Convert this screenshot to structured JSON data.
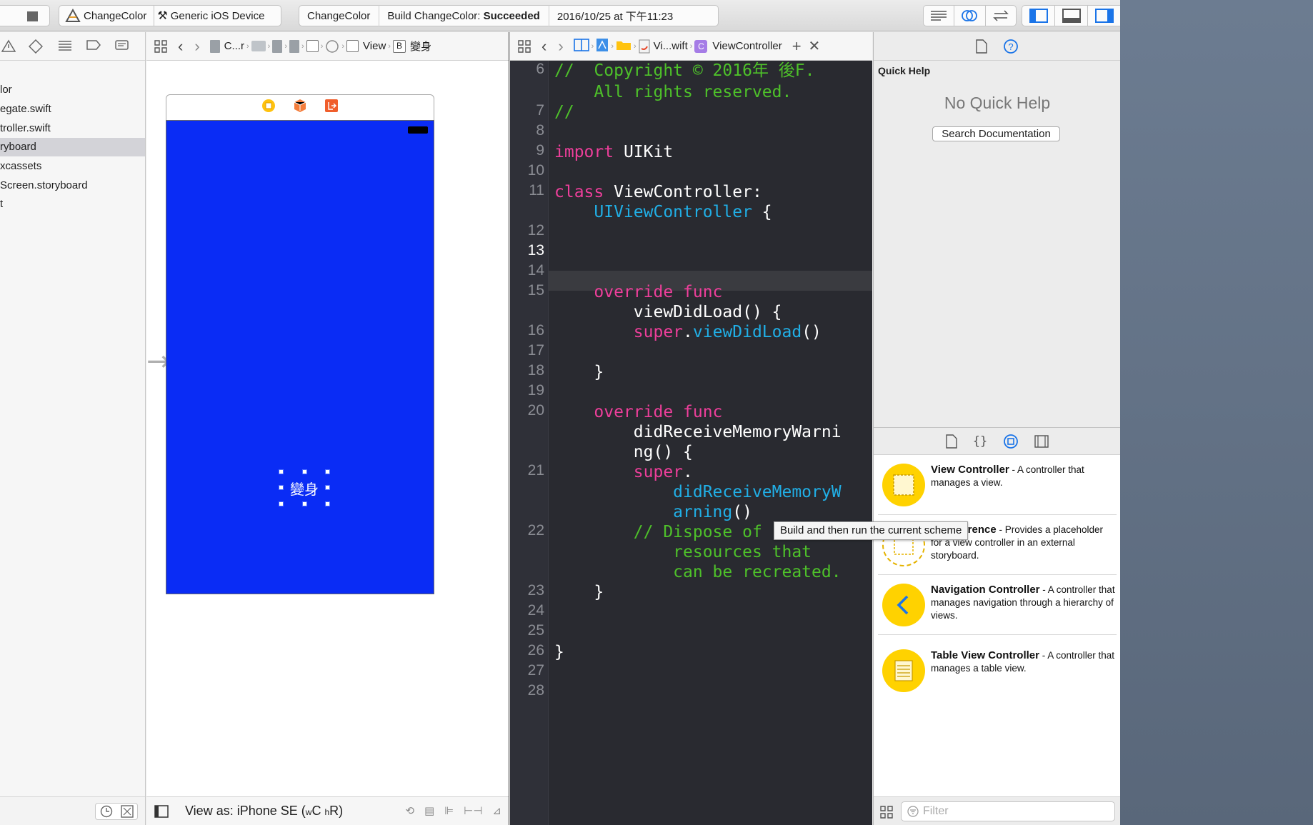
{
  "toolbar": {
    "scheme_name": "ChangeColor",
    "destination": "Generic iOS Device",
    "status_project": "ChangeColor",
    "status_prefix": "Build ChangeColor:",
    "status_result": "Succeeded",
    "status_time": "2016/10/25 at 下午11:23"
  },
  "navigator": {
    "items": [
      {
        "label": "lor"
      },
      {
        "label": "egate.swift"
      },
      {
        "label": "troller.swift"
      },
      {
        "label": "ryboard"
      },
      {
        "label": "xcassets"
      },
      {
        "label": "Screen.storyboard"
      },
      {
        "label": "t"
      }
    ]
  },
  "ib": {
    "jump": {
      "c1": "C...r",
      "view": "View",
      "button_badge": "B",
      "button": "變身"
    },
    "button_label": "變身",
    "view_as_prefix": "View as: iPhone SE (",
    "size_w": "w",
    "size_c": "C",
    "size_h": "h",
    "size_r": "R",
    "view_as_suffix": ")"
  },
  "editor": {
    "jump": {
      "file": "Vi...wift",
      "class_badge": "C",
      "class": "ViewController"
    },
    "line_numbers": [
      "6",
      "7",
      "8",
      "9",
      "10",
      "11",
      "12",
      "13",
      "14",
      "15",
      "16",
      "17",
      "18",
      "19",
      "20",
      "21",
      "22",
      "23",
      "24",
      "25",
      "26",
      "27",
      "28"
    ],
    "code": {
      "l6a": "//  Copyright © 2016年 後F.",
      "l6b": "    All rights reserved.",
      "l7": "//",
      "l9_kw": "import",
      "l9_rest": " UIKit",
      "l11_kw": "class",
      "l11_rest": " ViewController:",
      "l11b_ty": "    UIViewController",
      "l11b_rest": " {",
      "l15_kw": "    override func",
      "l15b": "        viewDidLoad() {",
      "l16_kw": "        super",
      "l16_dot": ".",
      "l16_ty": "viewDidLoad",
      "l16_rest": "()",
      "l18": "    }",
      "l20_kw": "    override func",
      "l20b": "        didReceiveMemoryWarni",
      "l20c": "        ng() {",
      "l21_kw": "        super",
      "l21_dot": ".",
      "l21b_ty": "            didReceiveMemoryW",
      "l21c_ty": "            arning",
      "l21c_rest": "()",
      "l22": "        // Dispose of",
      "l22b": "            resources that",
      "l22c": "            can be recreated.",
      "l23": "    }",
      "l26": "}"
    }
  },
  "tooltip": "Build and then run the current scheme",
  "inspector": {
    "title": "Quick Help",
    "empty": "No Quick Help",
    "search_button": "Search Documentation"
  },
  "library": {
    "items": [
      {
        "title": "View Controller",
        "desc": " - A controller that manages a view."
      },
      {
        "title": "rd Reference",
        "desc": " - Provides a placeholder for a view controller in an external storyboard."
      },
      {
        "title": "Navigation Controller",
        "desc": " - A controller that manages navigation through a hierarchy of views."
      },
      {
        "title": "Table View Controller",
        "desc": " - A controller that manages a table view."
      }
    ],
    "filter_placeholder": "Filter"
  },
  "colors": {
    "scene_background": "#0a2cf5",
    "editor_background": "#292a30",
    "comment": "#4ec12a",
    "keyword": "#ee3f9b",
    "type": "#21afe6",
    "library_icon": "#ffd200"
  }
}
